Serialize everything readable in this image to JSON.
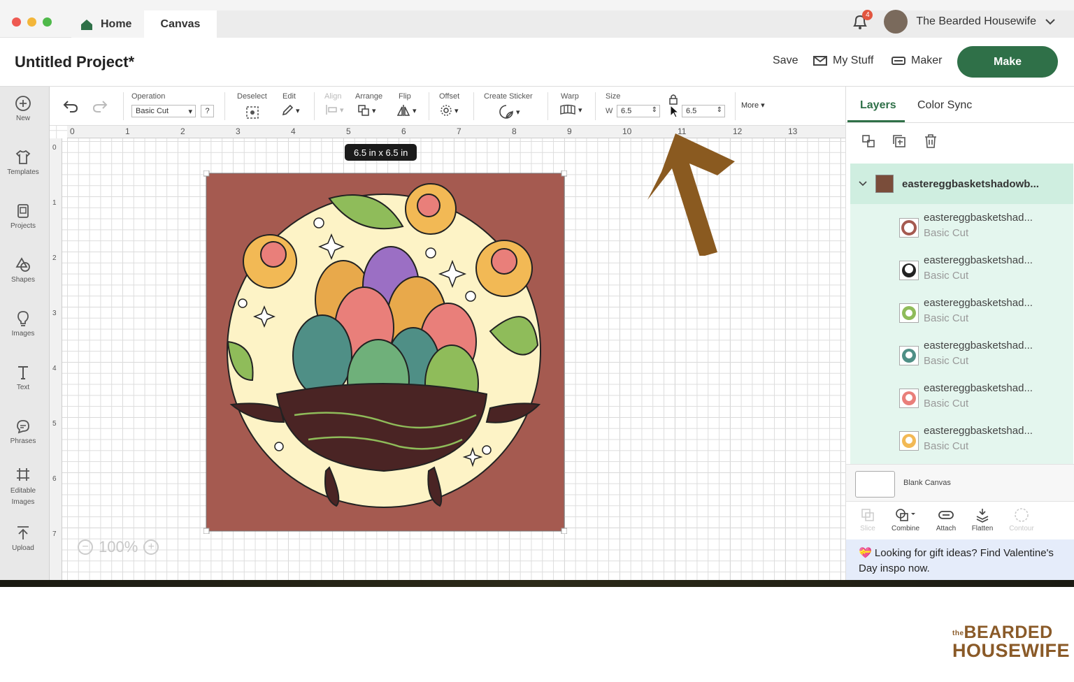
{
  "window": {
    "tabs": [
      {
        "label": "Home"
      },
      {
        "label": "Canvas"
      }
    ],
    "notification_count": "4",
    "user_name": "The Bearded Housewife"
  },
  "header": {
    "title": "Untitled Project*",
    "save": "Save",
    "my_stuff": "My Stuff",
    "maker": "Maker",
    "make": "Make"
  },
  "sidebar": {
    "items": [
      {
        "label": "New",
        "icon": "plus-circle-icon"
      },
      {
        "label": "Templates",
        "icon": "tshirt-icon"
      },
      {
        "label": "Projects",
        "icon": "projects-icon"
      },
      {
        "label": "Shapes",
        "icon": "shapes-icon"
      },
      {
        "label": "Images",
        "icon": "lightbulb-icon"
      },
      {
        "label": "Text",
        "icon": "text-icon"
      },
      {
        "label": "Phrases",
        "icon": "phrases-icon"
      },
      {
        "label": "Editable",
        "label2": "Images",
        "icon": "editable-images-icon"
      },
      {
        "label": "Upload",
        "icon": "upload-icon"
      }
    ]
  },
  "toolbar": {
    "operation_label": "Operation",
    "operation_value": "Basic Cut",
    "help": "?",
    "deselect": "Deselect",
    "edit": "Edit",
    "align": "Align",
    "arrange": "Arrange",
    "flip": "Flip",
    "offset": "Offset",
    "create_sticker": "Create Sticker",
    "warp": "Warp",
    "size": "Size",
    "w_label": "W",
    "w_value": "6.5",
    "h_value": "6.5",
    "more": "More"
  },
  "canvas": {
    "ruler_top": [
      "0",
      "1",
      "2",
      "3",
      "4",
      "5",
      "6",
      "7",
      "8",
      "9",
      "10",
      "11",
      "12",
      "13"
    ],
    "ruler_left": [
      "0",
      "1",
      "2",
      "3",
      "4",
      "5",
      "6",
      "7"
    ],
    "size_tooltip": "6.5  in x 6.5  in",
    "zoom": "100%",
    "artwork_bg": "#a55a50",
    "arrow_color": "#8a5a20"
  },
  "panel": {
    "tabs": [
      "Layers",
      "Color Sync"
    ],
    "group_name": "eastereggbasketshadowb...",
    "layers": [
      {
        "name": "eastereggbasketshad...",
        "op": "Basic Cut"
      },
      {
        "name": "eastereggbasketshad...",
        "op": "Basic Cut"
      },
      {
        "name": "eastereggbasketshad...",
        "op": "Basic Cut"
      },
      {
        "name": "eastereggbasketshad...",
        "op": "Basic Cut"
      },
      {
        "name": "eastereggbasketshad...",
        "op": "Basic Cut"
      },
      {
        "name": "eastereggbasketshad...",
        "op": "Basic Cut"
      }
    ],
    "blank_canvas": "Blank Canvas",
    "actions": [
      "Slice",
      "Combine",
      "Attach",
      "Flatten",
      "Contour"
    ],
    "promo": "Looking for gift ideas? Find Valentine's Day inspo now."
  },
  "watermark": {
    "line1": "BEARDED",
    "small": "the",
    "line2": "HOUSEWIFE"
  },
  "colors": {
    "accent": "#2f7048",
    "layer_bg": "#e4f6ee",
    "group_bg": "#cfeee0"
  }
}
